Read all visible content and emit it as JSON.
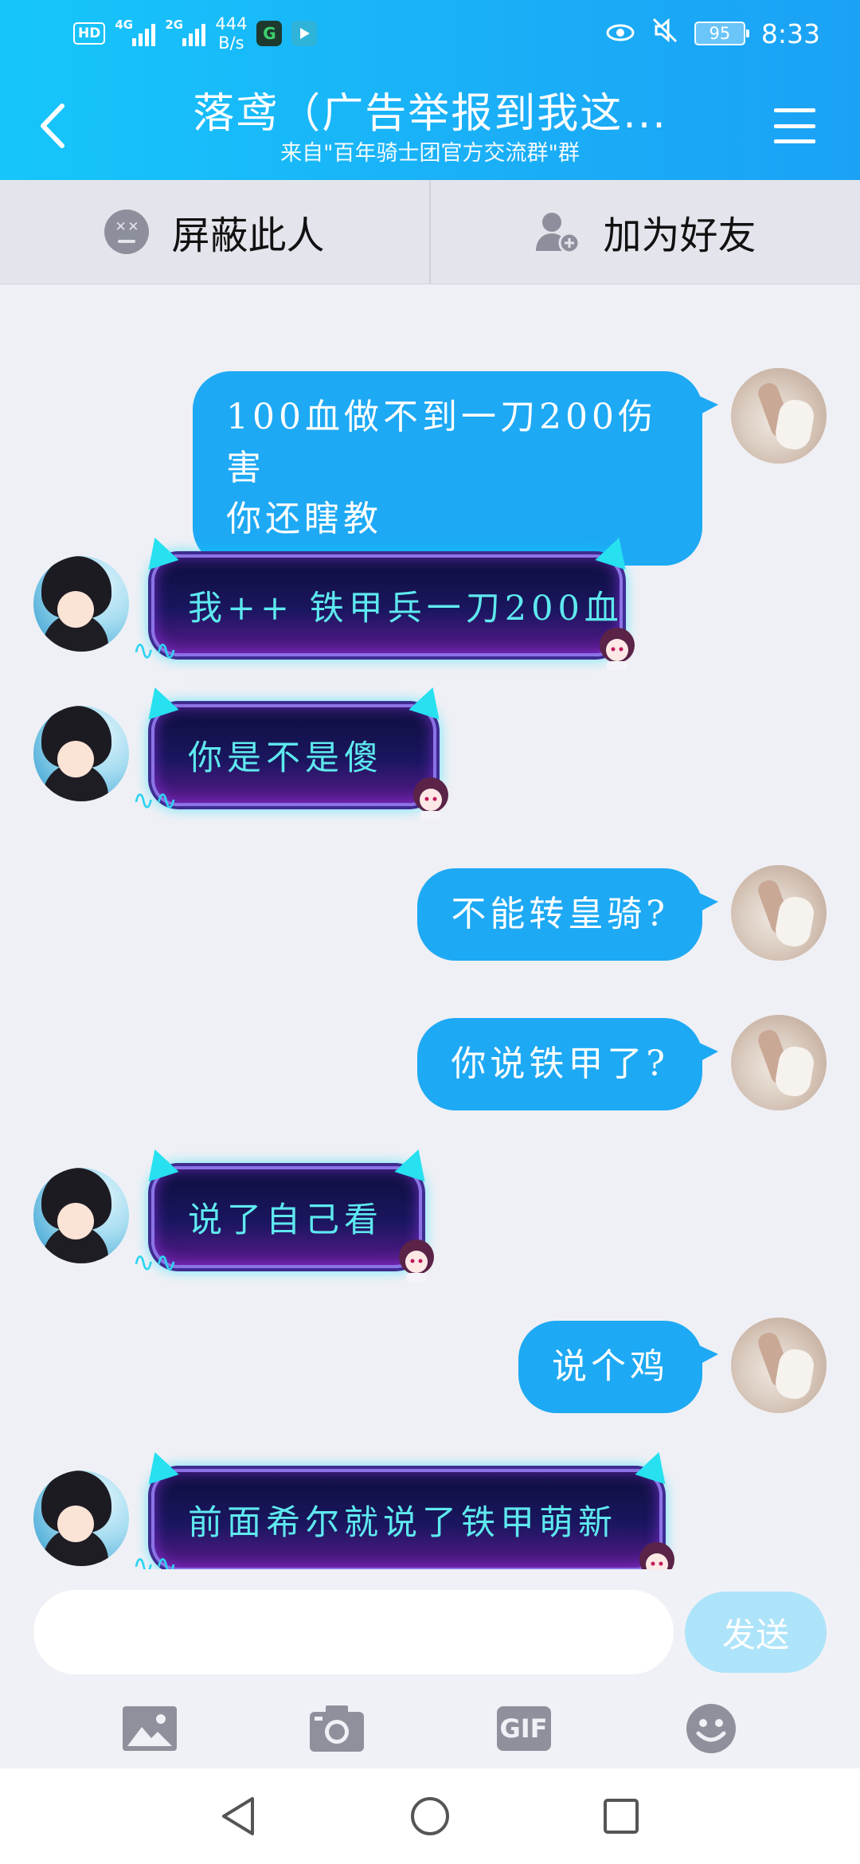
{
  "status_bar": {
    "hd": "HD",
    "net1": "4G",
    "net2": "2G",
    "speed_value": "444",
    "speed_unit": "B/s",
    "battery": "95",
    "time": "8:33",
    "app1_icon": "G"
  },
  "header": {
    "title": "落鸢（广告举报到我这...",
    "subtitle": "来自\"百年骑士团官方交流群\"群"
  },
  "actions": {
    "block_label": "屏蔽此人",
    "add_friend_label": "加为好友"
  },
  "messages": [
    {
      "side": "right",
      "text": "100血做不到一刀200伤害\n你还瞎教"
    },
    {
      "side": "left",
      "text": "我++ 铁甲兵一刀200血"
    },
    {
      "side": "left",
      "text": "你是不是傻"
    },
    {
      "side": "right",
      "text": "不能转皇骑?"
    },
    {
      "side": "right",
      "text": "你说铁甲了?"
    },
    {
      "side": "left",
      "text": "说了自己看"
    },
    {
      "side": "right",
      "text": "说个鸡"
    },
    {
      "side": "left",
      "text": "前面希尔就说了铁甲萌新"
    }
  ],
  "input": {
    "value": "",
    "send_label": "发送",
    "gif_label": "GIF"
  },
  "colors": {
    "header": "#1aaef7",
    "bubble_right": "#1ea9f4",
    "send_button": "#aee4fa",
    "bubble_left_text": "#5ee9ef"
  }
}
